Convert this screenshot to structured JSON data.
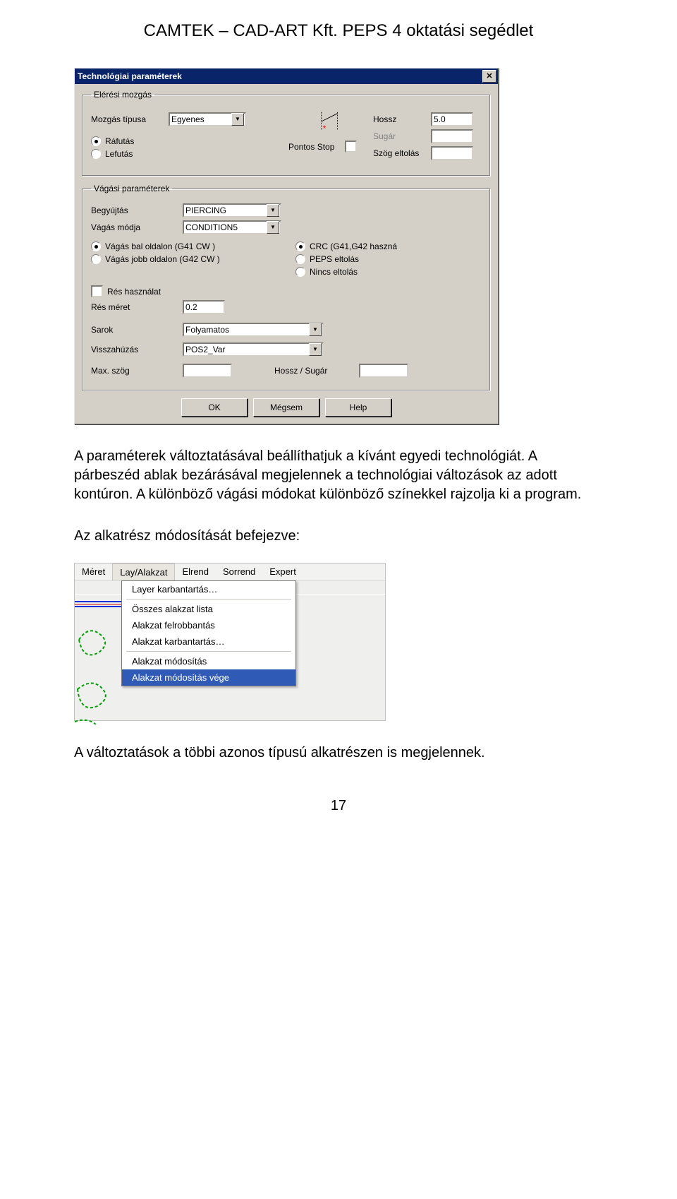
{
  "doc": {
    "header": "CAMTEK – CAD-ART Kft. PEPS 4 oktatási segédlet",
    "para1": "A paraméterek változtatásával beállíthatjuk a kívánt egyedi technológiát. A párbeszéd ablak bezárásával  megjelennek a technológiai változások az adott kontúron. A különböző vágási módokat különböző színekkel rajzolja ki a program.",
    "para2": "Az alkatrész módosítását befejezve:",
    "para3": "A változtatások a többi azonos típusú alkatrészen is megjelennek.",
    "page_number": "17"
  },
  "dialog": {
    "title": "Technológiai paraméterek",
    "group1": {
      "legend": "Elérési mozgás",
      "mozgas_label": "Mozgás típusa",
      "mozgas_value": "Egyenes",
      "radio_rafutas": "Ráfutás",
      "radio_lefutas": "Lefutás",
      "pontos_stop": "Pontos Stop",
      "hossz_label": "Hossz",
      "hossz_value": "5.0",
      "sugar_label": "Sugár",
      "szog_label": "Szög eltolás"
    },
    "group2": {
      "legend": "Vágási paraméterek",
      "begyujtas_label": "Begyújtás",
      "begyujtas_value": "PIERCING",
      "vagasmod_label": "Vágás módja",
      "vagasmod_value": "CONDITION5",
      "radio_bal": "Vágás bal oldalon  (G41 CW )",
      "radio_jobb": "Vágás jobb oldalon  (G42 CW )",
      "radio_crc": "CRC (G41,G42 haszná",
      "radio_peps": "PEPS eltolás",
      "radio_nincs": "Nincs eltolás",
      "res_check": "Rés használat",
      "resmeret_label": "Rés méret",
      "resmeret_value": "0.2",
      "sarok_label": "Sarok",
      "sarok_value": "Folyamatos",
      "vissza_label": "Visszahúzás",
      "vissza_value": "POS2_Var",
      "maxszog_label": "Max. szög",
      "hossz_sugar_label": "Hossz / Sugár"
    },
    "buttons": {
      "ok": "OK",
      "cancel": "Mégsem",
      "help": "Help"
    }
  },
  "menu": {
    "bar": {
      "meret": "Méret",
      "lay": "Lay/Alakzat",
      "elrend": "Elrend",
      "sorrend": "Sorrend",
      "expert": "Expert"
    },
    "items": {
      "layer_karb": "Layer karbantartás…",
      "osszes": "Összes alakzat lista",
      "felrobb": "Alakzat felrobbantás",
      "alak_karb": "Alakzat karbantartás…",
      "modositas": "Alakzat módosítás",
      "modositas_vege": "Alakzat módosítás vége"
    }
  }
}
